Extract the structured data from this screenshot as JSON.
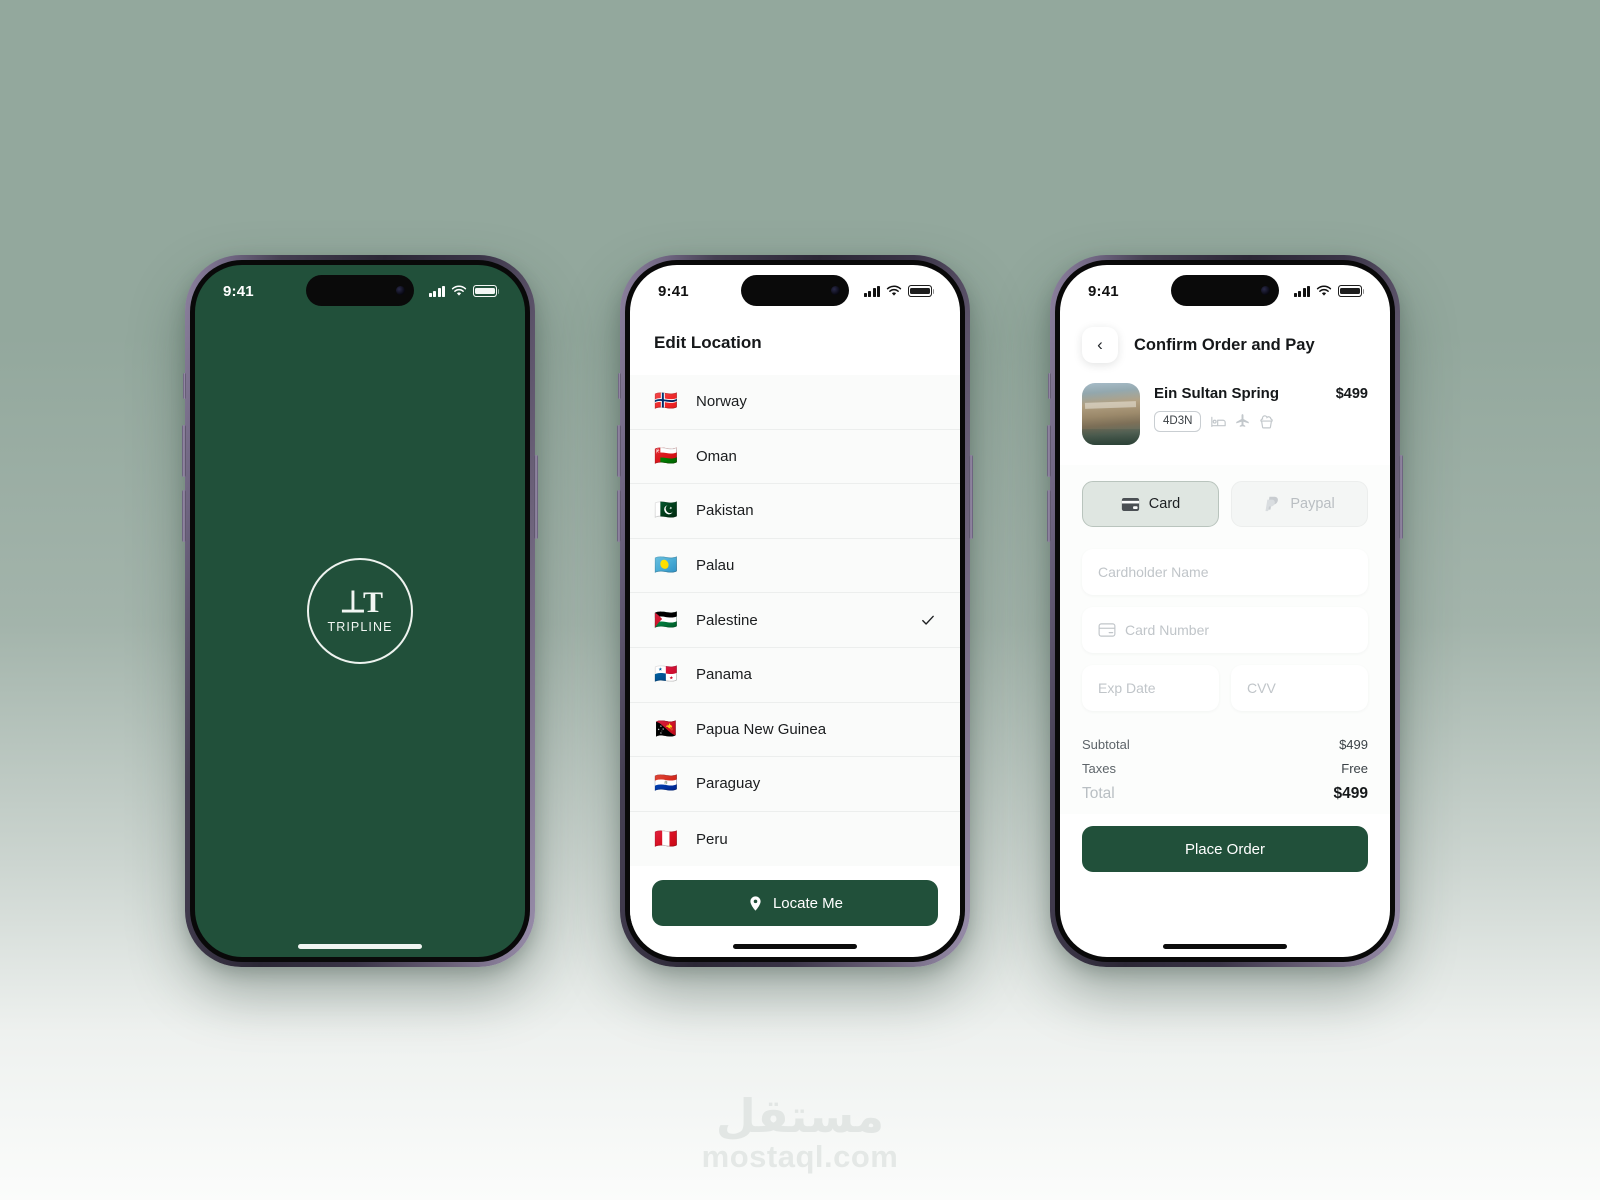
{
  "theme": {
    "brand_green": "#21503a",
    "background_top": "#93a89d",
    "background_bottom": "#fbfcfb"
  },
  "status_bar": {
    "time": "9:41"
  },
  "phone1": {
    "name": "splash-screen",
    "logo_mark": "⊥T",
    "logo_word": "TRIPLINE"
  },
  "phone2": {
    "title": "Edit Location",
    "countries": [
      {
        "flag": "🇳🇴",
        "name": "Norway",
        "selected": false
      },
      {
        "flag": "🇴🇲",
        "name": "Oman",
        "selected": false
      },
      {
        "flag": "🇵🇰",
        "name": "Pakistan",
        "selected": false
      },
      {
        "flag": "🇵🇼",
        "name": "Palau",
        "selected": false
      },
      {
        "flag": "🇵🇸",
        "name": "Palestine",
        "selected": true
      },
      {
        "flag": "🇵🇦",
        "name": "Panama",
        "selected": false
      },
      {
        "flag": "🇵🇬",
        "name": "Papua New Guinea",
        "selected": false
      },
      {
        "flag": "🇵🇾",
        "name": "Paraguay",
        "selected": false
      },
      {
        "flag": "🇵🇪",
        "name": "Peru",
        "selected": false
      }
    ],
    "locate_button": "Locate Me"
  },
  "phone3": {
    "title": "Confirm Order and Pay",
    "back_label": "‹",
    "product": {
      "name": "Ein Sultan Spring",
      "price": "$499",
      "duration_badge": "4D3N",
      "amenities": [
        "hotel-icon",
        "flight-icon",
        "food-icon"
      ]
    },
    "payment_tabs": [
      {
        "label": "Card",
        "icon": "credit-card-icon",
        "active": true
      },
      {
        "label": "Paypal",
        "icon": "paypal-icon",
        "active": false
      }
    ],
    "form": {
      "cardholder_placeholder": "Cardholder Name",
      "card_number_placeholder": "Card Number",
      "exp_date_placeholder": "Exp Date",
      "cvv_placeholder": "CVV"
    },
    "totals": [
      {
        "label": "Subtotal",
        "value": "$499",
        "grand": false
      },
      {
        "label": "Taxes",
        "value": "Free",
        "grand": false
      },
      {
        "label": "Total",
        "value": "$499",
        "grand": true
      }
    ],
    "place_order_button": "Place Order"
  },
  "watermark": {
    "arabic": "مستقل",
    "latin": "mostaql.com"
  }
}
